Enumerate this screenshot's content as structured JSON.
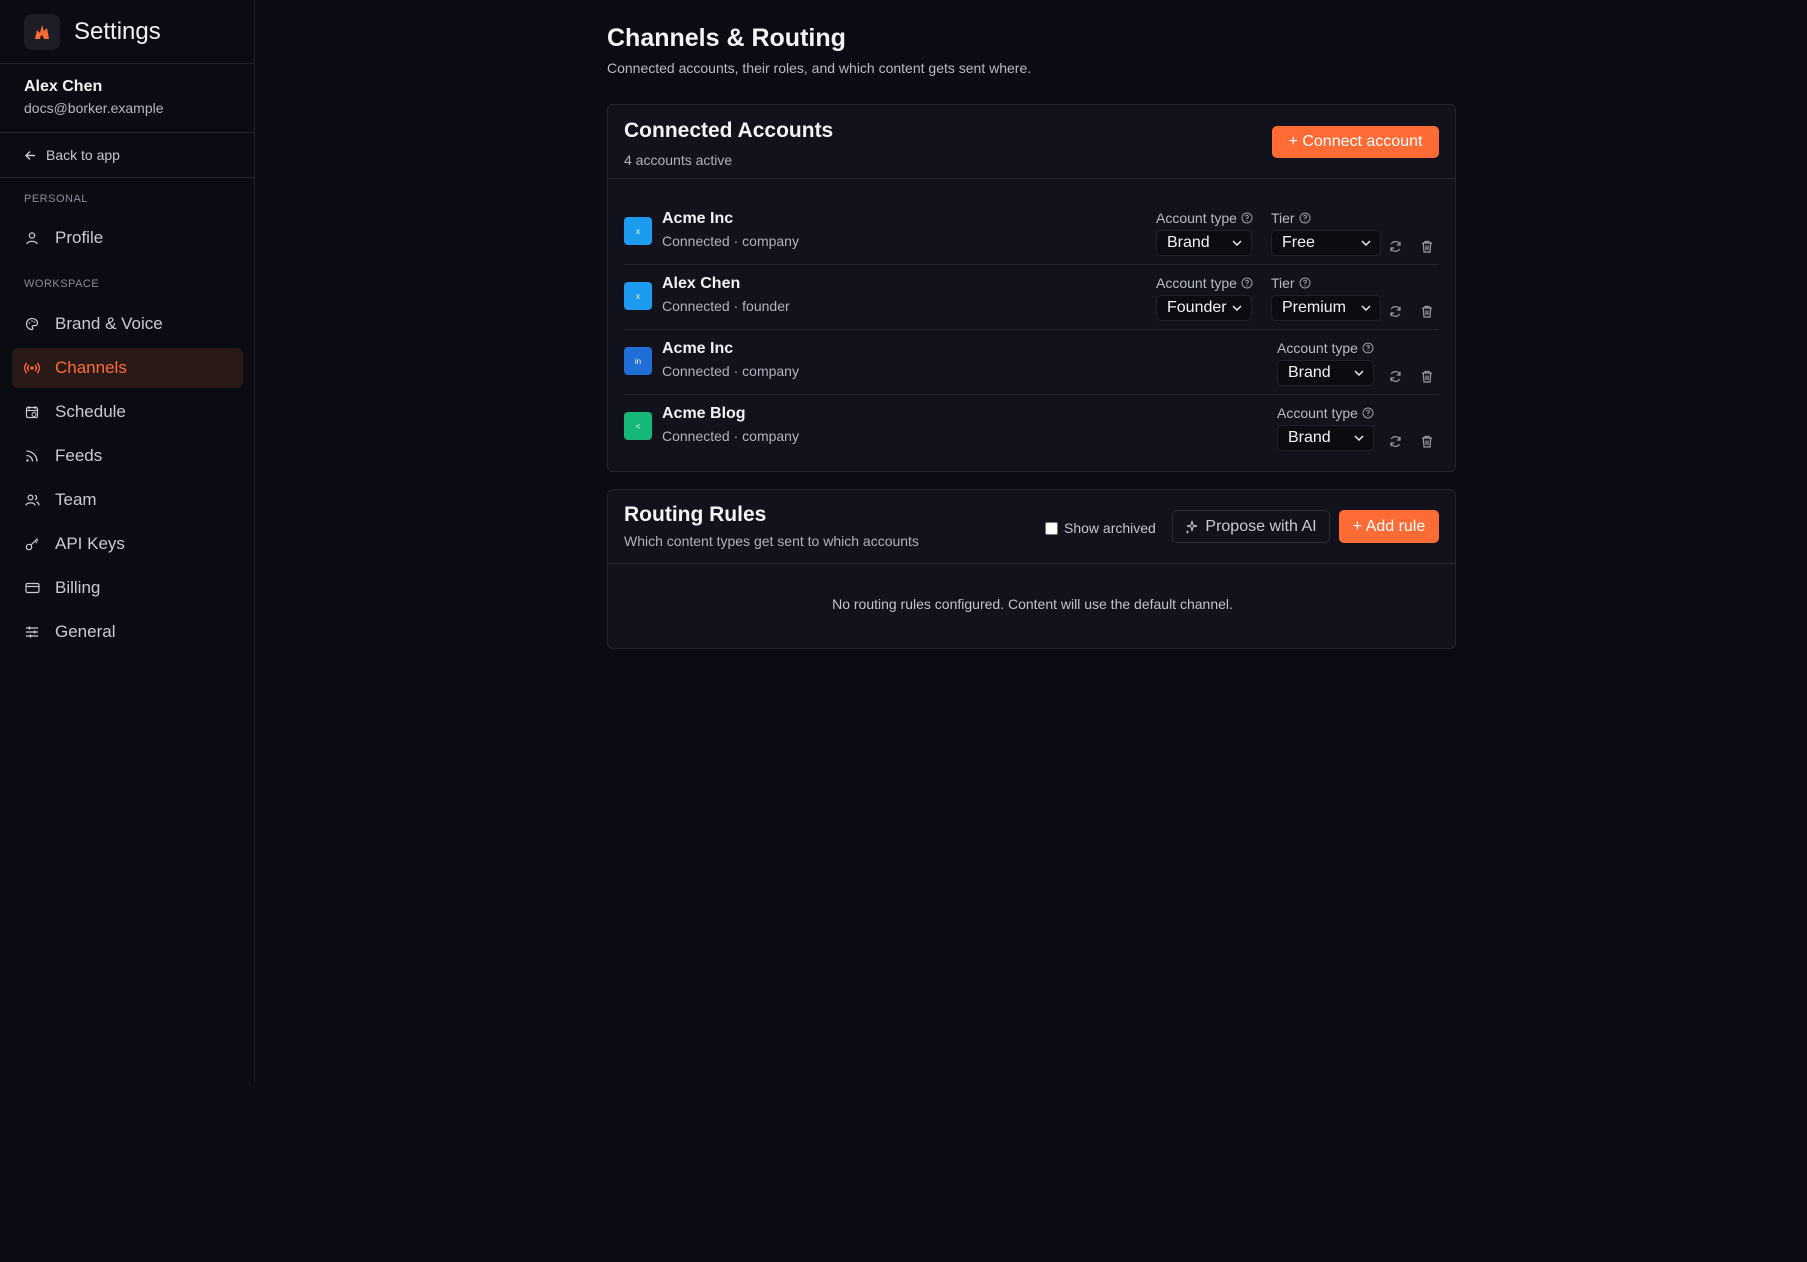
{
  "sidebar": {
    "title": "Settings",
    "user": {
      "name": "Alex Chen",
      "email": "docs@borker.example"
    },
    "back_label": "Back to app",
    "sections": {
      "personal": "PERSONAL",
      "workspace": "WORKSPACE"
    },
    "items": [
      {
        "label": "Profile",
        "icon": "user-icon"
      },
      {
        "label": "Brand & Voice",
        "icon": "palette-icon"
      },
      {
        "label": "Channels",
        "icon": "broadcast-icon",
        "active": true
      },
      {
        "label": "Schedule",
        "icon": "calendar-clock-icon"
      },
      {
        "label": "Feeds",
        "icon": "rss-icon"
      },
      {
        "label": "Team",
        "icon": "users-icon"
      },
      {
        "label": "API Keys",
        "icon": "key-icon"
      },
      {
        "label": "Billing",
        "icon": "credit-card-icon"
      },
      {
        "label": "General",
        "icon": "sliders-icon"
      }
    ]
  },
  "page": {
    "title": "Channels & Routing",
    "subtitle": "Connected accounts, their roles, and which content gets sent where."
  },
  "accounts_card": {
    "title": "Connected Accounts",
    "subtitle": "4 accounts active",
    "connect_label": "+ Connect account",
    "account_type_label": "Account type",
    "tier_label": "Tier",
    "accounts": [
      {
        "name": "Acme Inc",
        "status": "Connected · company",
        "platform": "x-icon",
        "icon_glyph": "x",
        "icon_color": "#1d9bf0",
        "account_type": "Brand",
        "tier": "Free"
      },
      {
        "name": "Alex Chen",
        "status": "Connected · founder",
        "platform": "x-icon",
        "icon_glyph": "x",
        "icon_color": "#1d9bf0",
        "account_type": "Founder",
        "tier": "Premium"
      },
      {
        "name": "Acme Inc",
        "status": "Connected · company",
        "platform": "linkedin-icon",
        "icon_glyph": "in",
        "icon_color": "#1f6fd6",
        "account_type": "Brand"
      },
      {
        "name": "Acme Blog",
        "status": "Connected · company",
        "platform": "blog-icon",
        "icon_glyph": "<",
        "icon_color": "#16b87a",
        "account_type": "Brand"
      }
    ]
  },
  "routing_card": {
    "title": "Routing Rules",
    "subtitle": "Which content types get sent to which accounts",
    "show_archived_label": "Show archived",
    "show_archived": false,
    "propose_label": "Propose with AI",
    "add_rule_label": "+ Add rule",
    "empty_text": "No routing rules configured. Content will use the default channel."
  },
  "colors": {
    "accent": "#ff6b35",
    "background": "#0b0b14",
    "card": "#11121b"
  }
}
